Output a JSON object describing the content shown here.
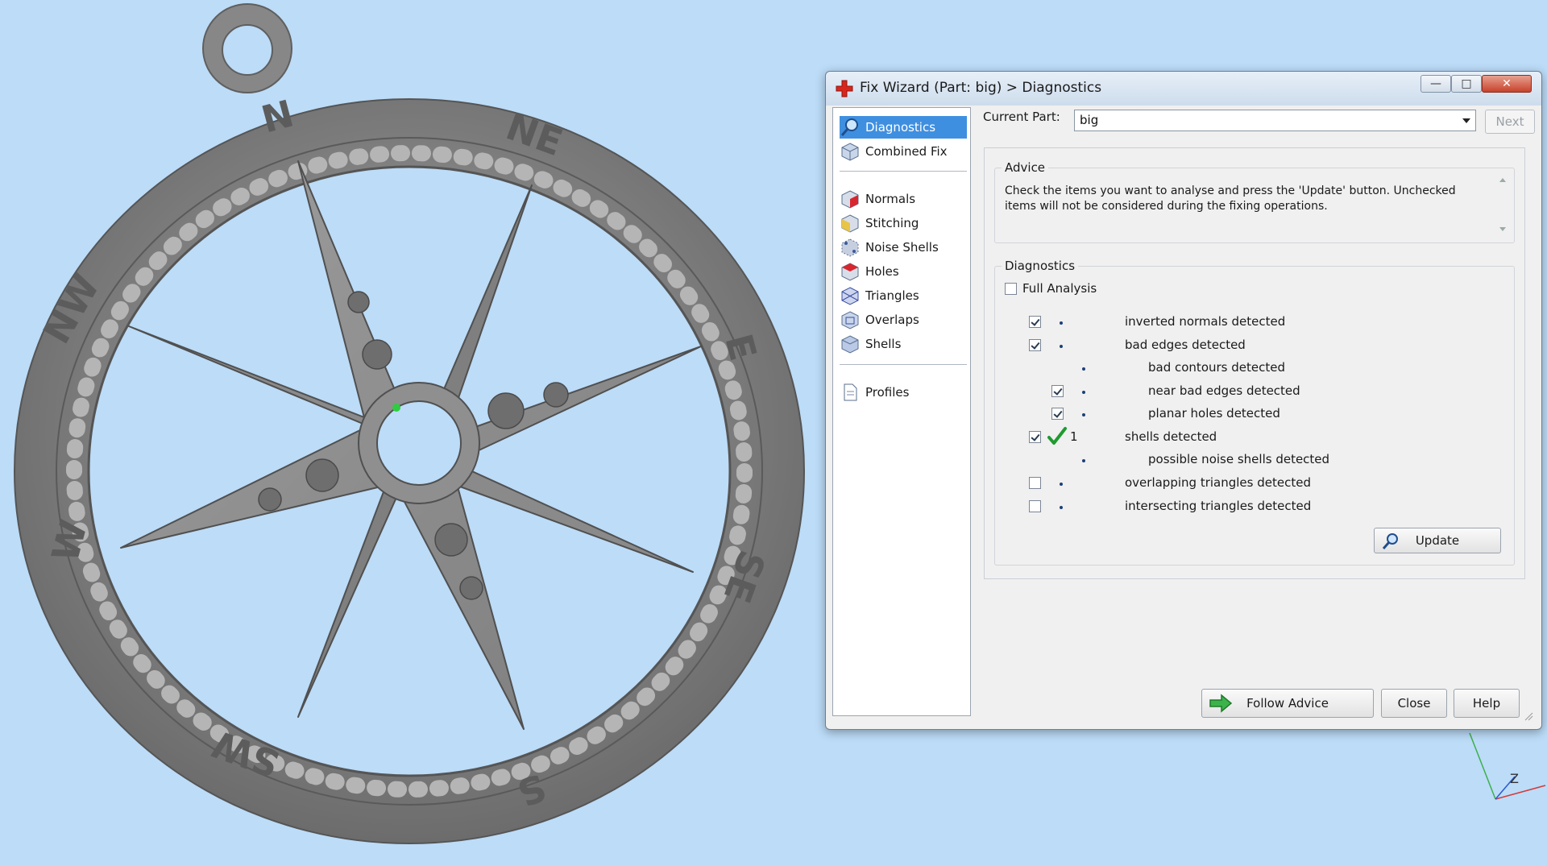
{
  "window": {
    "title": "Fix Wizard (Part: big) > Diagnostics",
    "min_label": "—",
    "max_label": "□",
    "close_label": "✕"
  },
  "nav": {
    "items": [
      {
        "label": "Diagnostics",
        "icon": "magnifier-icon",
        "active": true
      },
      {
        "label": "Combined Fix",
        "icon": "cube-icon"
      },
      {
        "label": "Normals",
        "icon": "normals-cube-icon"
      },
      {
        "label": "Stitching",
        "icon": "stitching-cube-icon"
      },
      {
        "label": "Noise Shells",
        "icon": "noise-shells-icon"
      },
      {
        "label": "Holes",
        "icon": "holes-cube-icon"
      },
      {
        "label": "Triangles",
        "icon": "triangles-cube-icon"
      },
      {
        "label": "Overlaps",
        "icon": "overlaps-cube-icon"
      },
      {
        "label": "Shells",
        "icon": "shells-cube-icon"
      },
      {
        "label": "Profiles",
        "icon": "document-icon"
      }
    ]
  },
  "current_part": {
    "label": "Current Part:",
    "value": "big"
  },
  "next_label": "Next",
  "advice": {
    "title": "Advice",
    "text": "Check the items you want to analyse and press the 'Update' button. Unchecked items will not be considered during the fixing operations."
  },
  "diagnostics": {
    "title": "Diagnostics",
    "full_analysis_label": "Full Analysis",
    "full_analysis_checked": false,
    "rows": [
      {
        "label": "inverted normals detected",
        "checked": true,
        "indent": 0,
        "result": ""
      },
      {
        "label": "bad edges detected",
        "checked": true,
        "indent": 0,
        "result": ""
      },
      {
        "label": "bad contours detected",
        "checked": null,
        "indent": 1,
        "result": ""
      },
      {
        "label": "near bad edges detected",
        "checked": true,
        "indent": 1,
        "result": ""
      },
      {
        "label": "planar holes detected",
        "checked": true,
        "indent": 1,
        "result": ""
      },
      {
        "label": "shells detected",
        "checked": true,
        "indent": 0,
        "result": "1"
      },
      {
        "label": "possible noise shells detected",
        "checked": null,
        "indent": 1,
        "result": ""
      },
      {
        "label": "overlapping triangles detected",
        "checked": false,
        "indent": 0,
        "result": ""
      },
      {
        "label": "intersecting triangles detected",
        "checked": false,
        "indent": 0,
        "result": ""
      }
    ],
    "update_label": "Update"
  },
  "footer": {
    "follow_advice_label": "Follow Advice",
    "close_label": "Close",
    "help_label": "Help"
  },
  "viewport": {
    "compass_labels": [
      "N",
      "NE",
      "E",
      "SE",
      "S",
      "SW",
      "W",
      "NW"
    ],
    "axis_label": "Z"
  },
  "colors": {
    "background": "#bcdcf8",
    "model": "#8e8e8e",
    "selection": "#3f8fe0"
  }
}
